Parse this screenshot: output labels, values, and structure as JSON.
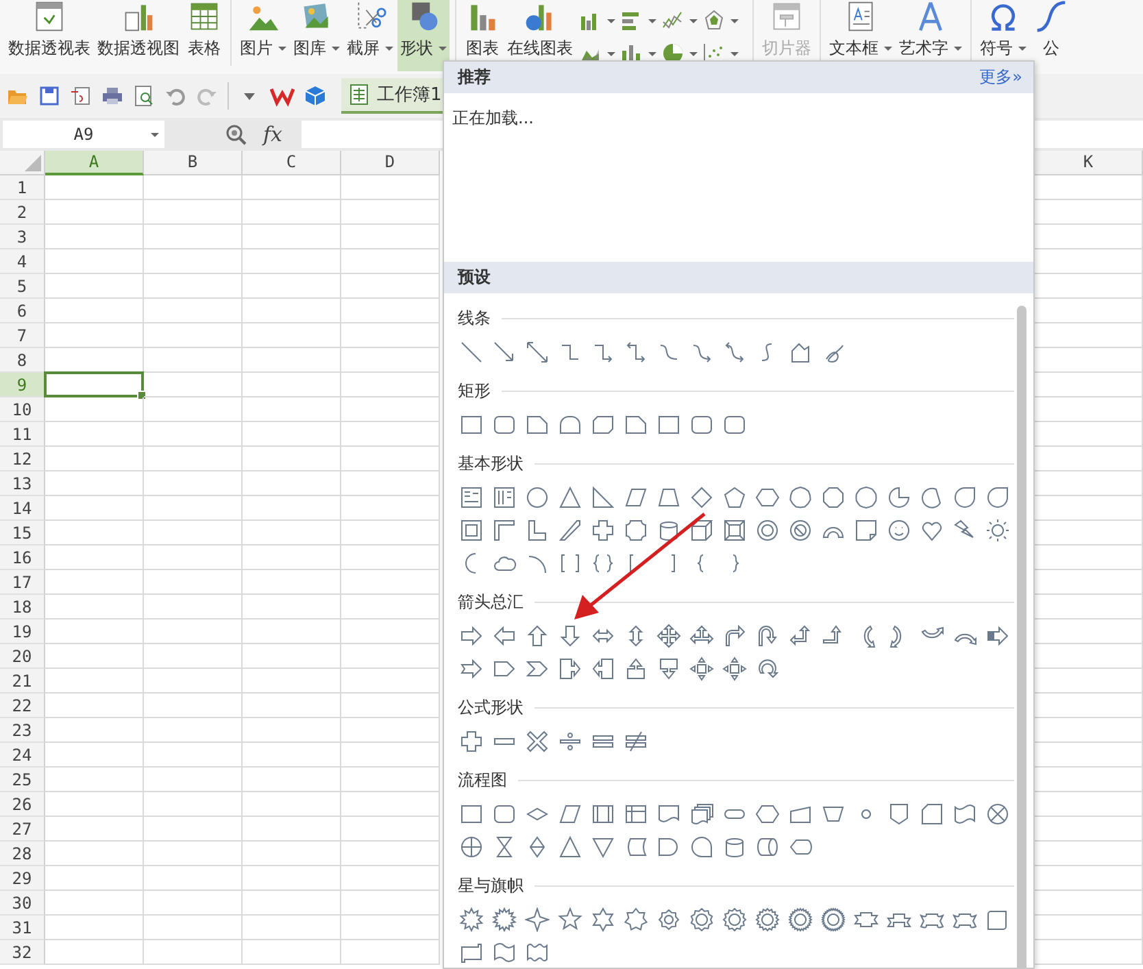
{
  "ribbon": {
    "items": [
      {
        "kind": "button",
        "label": "数据透视表",
        "dropdown": false,
        "selected": false,
        "disabled": false
      },
      {
        "kind": "button",
        "label": "数据透视图",
        "dropdown": false,
        "selected": false,
        "disabled": false
      },
      {
        "kind": "button",
        "label": "表格",
        "dropdown": false,
        "selected": false,
        "disabled": false
      },
      {
        "kind": "separator"
      },
      {
        "kind": "button",
        "label": "图片",
        "dropdown": true,
        "selected": false,
        "disabled": false
      },
      {
        "kind": "button",
        "label": "图库",
        "dropdown": true,
        "selected": false,
        "disabled": false
      },
      {
        "kind": "button",
        "label": "截屏",
        "dropdown": true,
        "selected": false,
        "disabled": false
      },
      {
        "kind": "button",
        "label": "形状",
        "dropdown": true,
        "selected": true,
        "disabled": false
      },
      {
        "kind": "separator"
      },
      {
        "kind": "button",
        "label": "图表",
        "dropdown": false,
        "selected": false,
        "disabled": false
      },
      {
        "kind": "button",
        "label": "在线图表",
        "dropdown": false,
        "selected": false,
        "disabled": false
      },
      {
        "kind": "gallery"
      },
      {
        "kind": "separator"
      },
      {
        "kind": "button",
        "label": "切片器",
        "dropdown": false,
        "selected": false,
        "disabled": true
      },
      {
        "kind": "separator"
      },
      {
        "kind": "button",
        "label": "文本框",
        "dropdown": true,
        "selected": false,
        "disabled": false
      },
      {
        "kind": "button",
        "label": "艺术字",
        "dropdown": true,
        "selected": false,
        "disabled": false
      },
      {
        "kind": "separator"
      },
      {
        "kind": "button",
        "label": "符号",
        "dropdown": true,
        "selected": false,
        "disabled": false
      },
      {
        "kind": "button",
        "label": "公",
        "dropdown": false,
        "selected": false,
        "disabled": false
      }
    ]
  },
  "document_tab": {
    "label": "工作簿1",
    "selected": true
  },
  "formula_bar": {
    "name_box": "A9",
    "fx": "fx"
  },
  "sheet": {
    "columns": [
      {
        "label": "A",
        "selected": true
      },
      {
        "label": "B",
        "selected": false
      },
      {
        "label": "C",
        "selected": false
      },
      {
        "label": "D",
        "selected": false
      },
      {
        "label": "K",
        "selected": false
      }
    ],
    "rows": [
      {
        "label": "1",
        "selected": false
      },
      {
        "label": "2",
        "selected": false
      },
      {
        "label": "3",
        "selected": false
      },
      {
        "label": "4",
        "selected": false
      },
      {
        "label": "5",
        "selected": false
      },
      {
        "label": "6",
        "selected": false
      },
      {
        "label": "7",
        "selected": false
      },
      {
        "label": "8",
        "selected": false
      },
      {
        "label": "9",
        "selected": true
      },
      {
        "label": "10",
        "selected": false
      },
      {
        "label": "11",
        "selected": false
      },
      {
        "label": "12",
        "selected": false
      },
      {
        "label": "13",
        "selected": false
      },
      {
        "label": "14",
        "selected": false
      },
      {
        "label": "15",
        "selected": false
      },
      {
        "label": "16",
        "selected": false
      },
      {
        "label": "17",
        "selected": false
      },
      {
        "label": "18",
        "selected": false
      },
      {
        "label": "19",
        "selected": false
      },
      {
        "label": "20",
        "selected": false
      },
      {
        "label": "21",
        "selected": false
      },
      {
        "label": "22",
        "selected": false
      },
      {
        "label": "23",
        "selected": false
      },
      {
        "label": "24",
        "selected": false
      },
      {
        "label": "25",
        "selected": false
      },
      {
        "label": "26",
        "selected": false
      },
      {
        "label": "27",
        "selected": false
      },
      {
        "label": "28",
        "selected": false
      },
      {
        "label": "29",
        "selected": false
      },
      {
        "label": "30",
        "selected": false
      },
      {
        "label": "31",
        "selected": false
      },
      {
        "label": "32",
        "selected": false
      }
    ]
  },
  "shapes_panel": {
    "recommended_title": "推荐",
    "more_link": "更多»",
    "loading": "正在加载...",
    "presets_title": "预设",
    "sections": [
      {
        "title": "线条"
      },
      {
        "title": "矩形"
      },
      {
        "title": "基本形状"
      },
      {
        "title": "箭头总汇"
      },
      {
        "title": "公式形状"
      },
      {
        "title": "流程图"
      },
      {
        "title": "星与旗帜"
      }
    ]
  }
}
